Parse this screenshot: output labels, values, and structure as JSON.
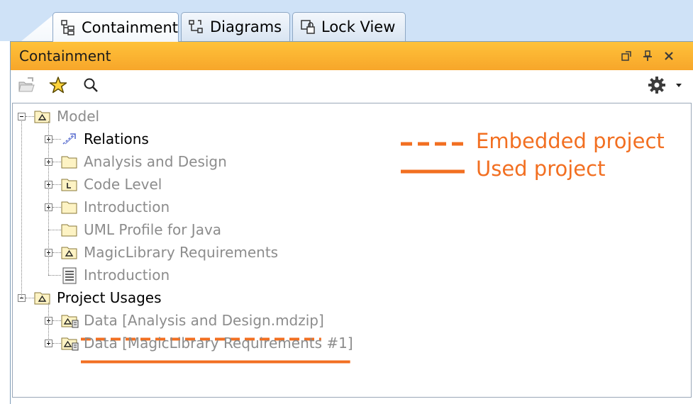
{
  "tabs": [
    {
      "label": "Containment",
      "icon": "containment-tree-icon",
      "active": true
    },
    {
      "label": "Diagrams",
      "icon": "diagram-icon",
      "active": false
    },
    {
      "label": "Lock View",
      "icon": "lock-view-icon",
      "active": false
    }
  ],
  "panel": {
    "title": "Containment",
    "title_buttons": [
      "restore-icon",
      "pin-icon",
      "close-icon"
    ]
  },
  "toolbar": {
    "left_icons": [
      "open-project-icon",
      "favorites-star-icon",
      "search-icon"
    ],
    "right_icons": [
      "gear-icon",
      "dropdown-arrow-icon"
    ]
  },
  "tree": [
    {
      "label": "Model",
      "icon": "model-package-icon",
      "expanded": true,
      "style": "grey",
      "children": [
        {
          "label": "Relations",
          "icon": "relations-icon",
          "style": "black"
        },
        {
          "label": "Analysis and Design",
          "icon": "package-icon",
          "style": "grey"
        },
        {
          "label": "Code Level",
          "icon": "package-l-icon",
          "style": "grey"
        },
        {
          "label": "Introduction",
          "icon": "package-icon",
          "style": "grey"
        },
        {
          "label": "UML Profile for Java",
          "icon": "package-icon",
          "style": "grey"
        },
        {
          "label": "MagicLibrary Requirements",
          "icon": "model-package-icon",
          "style": "grey"
        },
        {
          "label": "Introduction",
          "icon": "document-icon",
          "style": "grey"
        }
      ]
    },
    {
      "label": "Project Usages",
      "icon": "model-package-icon",
      "expanded": true,
      "style": "black",
      "children": [
        {
          "label": "Data [Analysis and Design.mdzip]",
          "icon": "used-model-icon",
          "style": "grey",
          "underline": "dashed"
        },
        {
          "label": "Data [MagicLibrary Requirements #1]",
          "icon": "used-model-icon",
          "style": "grey",
          "underline": "solid"
        }
      ]
    }
  ],
  "legend": [
    {
      "label": "Embedded project",
      "line": "dashed"
    },
    {
      "label": "Used project",
      "line": "solid"
    }
  ],
  "colors": {
    "accent_orange": "#f26f21",
    "title_bar": "#f9b233",
    "tab_strip": "#cfe2f7",
    "grey_text": "#8c8c8c"
  }
}
